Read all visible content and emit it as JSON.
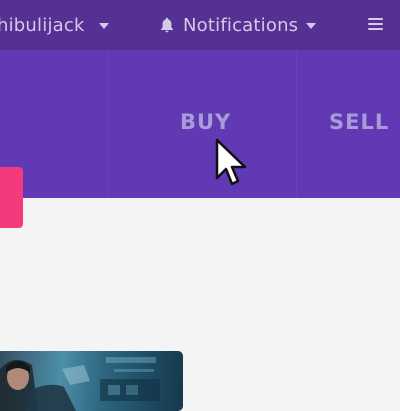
{
  "header": {
    "username": "hibulijack",
    "notifications_label": "Notifications"
  },
  "hero": {
    "nav": [
      {
        "label": "BUY"
      },
      {
        "label": "SELL"
      }
    ]
  },
  "colors": {
    "header_bg": "#553193",
    "hero_bg": "#6139b4",
    "nav_text": "#a99bd8",
    "accent_pink": "#f33a7d",
    "page_bg": "#f4f4f5"
  },
  "icons": {
    "notifications": "bell-icon",
    "menu": "hamburger-icon",
    "dropdown": "chevron-down-icon",
    "pointer": "mouse-cursor-icon"
  }
}
